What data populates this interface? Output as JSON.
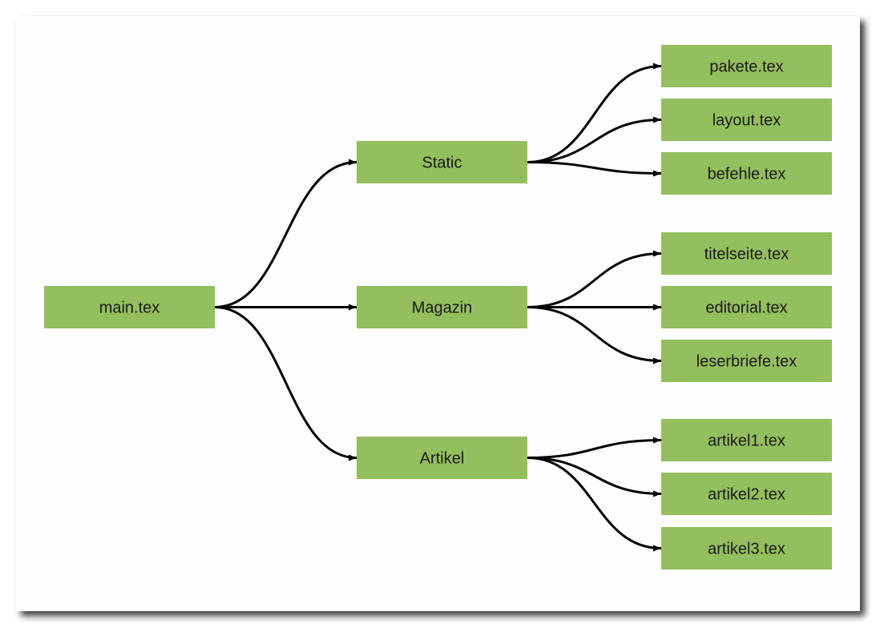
{
  "colors": {
    "node_fill": "#93bf5e",
    "edge": "#000000",
    "background": "#fefefe"
  },
  "nodes": [
    {
      "id": "main",
      "label": "main.tex"
    },
    {
      "id": "static",
      "label": "Static"
    },
    {
      "id": "magazin",
      "label": "Magazin"
    },
    {
      "id": "artikel",
      "label": "Artikel"
    },
    {
      "id": "pakete",
      "label": "pakete.tex"
    },
    {
      "id": "layout",
      "label": "layout.tex"
    },
    {
      "id": "befehle",
      "label": "befehle.tex"
    },
    {
      "id": "titelseite",
      "label": "titelseite.tex"
    },
    {
      "id": "editorial",
      "label": "editorial.tex"
    },
    {
      "id": "leserbriefe",
      "label": "leserbriefe.tex"
    },
    {
      "id": "artikel1",
      "label": "artikel1.tex"
    },
    {
      "id": "artikel2",
      "label": "artikel2.tex"
    },
    {
      "id": "artikel3",
      "label": "artikel3.tex"
    }
  ],
  "edges": [
    [
      "main",
      "static"
    ],
    [
      "main",
      "magazin"
    ],
    [
      "main",
      "artikel"
    ],
    [
      "static",
      "pakete"
    ],
    [
      "static",
      "layout"
    ],
    [
      "static",
      "befehle"
    ],
    [
      "magazin",
      "titelseite"
    ],
    [
      "magazin",
      "editorial"
    ],
    [
      "magazin",
      "leserbriefe"
    ],
    [
      "artikel",
      "artikel1"
    ],
    [
      "artikel",
      "artikel2"
    ],
    [
      "artikel",
      "artikel3"
    ]
  ]
}
